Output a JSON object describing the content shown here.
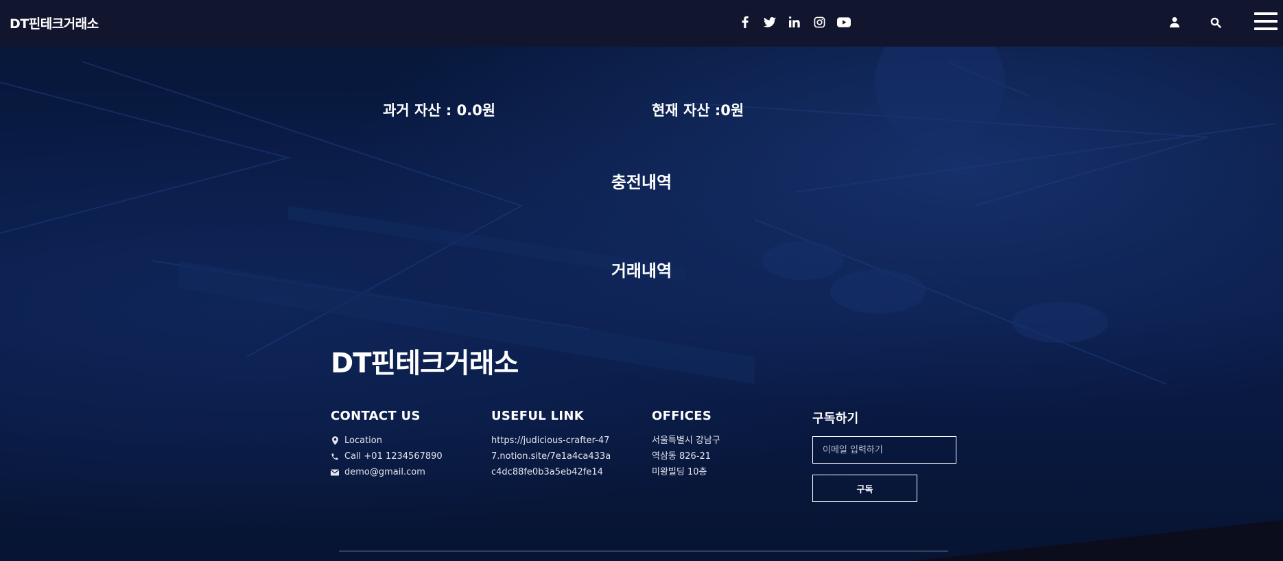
{
  "header": {
    "brand": "DT핀테크거래소",
    "social": [
      "facebook-icon",
      "twitter-icon",
      "linkedin-icon",
      "instagram-icon",
      "youtube-icon"
    ],
    "right_icons": [
      "user-icon",
      "search-icon",
      "hamburger-menu-icon"
    ]
  },
  "assets": {
    "past": "과거 자산 : 0.0원",
    "current": "현재 자산 :0원"
  },
  "sections": {
    "charge_history": "충전내역",
    "trade_history": "거래내역"
  },
  "footer": {
    "brand": "DT핀테크거래소",
    "contact": {
      "title": "CONTACT US",
      "location": "Location",
      "call": "Call +01 1234567890",
      "email": "demo@gmail.com"
    },
    "useful_link": {
      "title": "USEFUL LINK",
      "url": "https://judicious-crafter-477.notion.site/7e1a4ca433ac4dc88fe0b3a5eb42fe14"
    },
    "offices": {
      "title": "OFFICES",
      "lines": [
        "서울특별시 강남구",
        "역삼동 826-21",
        "미왕빌딩 10층"
      ]
    },
    "subscribe": {
      "title": "구독하기",
      "placeholder": "이메일 입력하기",
      "button": "구독"
    }
  },
  "colors": {
    "topbar": "#12152e",
    "background": "#0a1a44",
    "text": "#ffffff"
  }
}
